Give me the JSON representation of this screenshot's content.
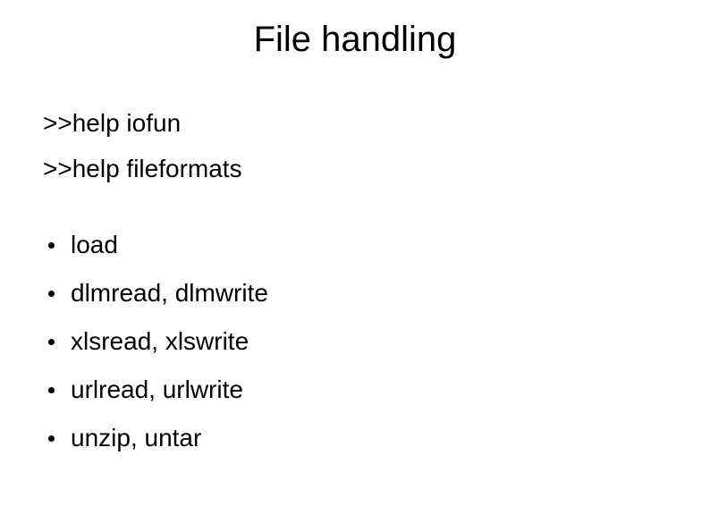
{
  "title": "File handling",
  "commands": [
    ">>help iofun",
    ">>help fileformats"
  ],
  "bullets": [
    "load",
    "dlmread, dlmwrite",
    "xlsread, xlswrite",
    "urlread, urlwrite",
    "unzip, untar"
  ]
}
